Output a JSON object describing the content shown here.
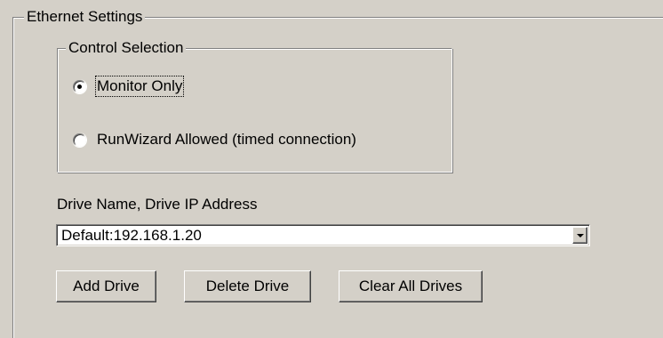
{
  "ethernet_settings": {
    "title": "Ethernet Settings",
    "control_selection": {
      "title": "Control Selection",
      "options": [
        {
          "label": "Monitor Only",
          "selected": true
        },
        {
          "label": "RunWizard Allowed (timed connection)",
          "selected": false
        }
      ]
    },
    "drive_list": {
      "label": "Drive Name, Drive IP Address",
      "selected_value": "Default:192.168.1.20"
    },
    "buttons": {
      "add_label": "Add Drive",
      "delete_label": "Delete Drive",
      "clear_all_label": "Clear All Drives"
    }
  },
  "icons": {
    "dropdown": "chevron-down-icon",
    "radio_selected": "radio-selected-icon",
    "radio_unselected": "radio-unselected-icon"
  },
  "colors": {
    "background": "#d4d0c8",
    "field_background": "#ffffff",
    "text": "#000000"
  }
}
